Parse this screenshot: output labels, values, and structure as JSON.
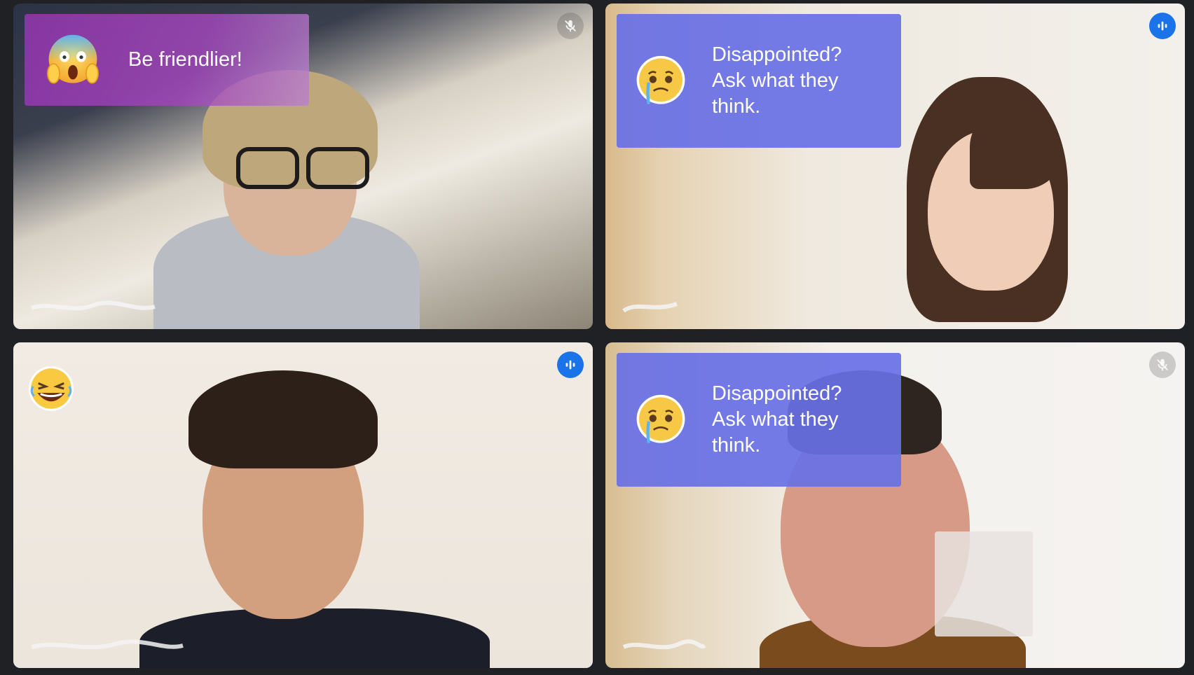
{
  "participants": [
    {
      "prompt": {
        "text": "Be friendlier!",
        "emoji": "face-screaming-in-fear-emoji"
      },
      "mic": {
        "state": "muted",
        "icon": "mic-off-icon"
      }
    },
    {
      "prompt": {
        "text": "Disappointed?\nAsk what they\nthink.",
        "emoji": "crying-face-emoji"
      },
      "mic": {
        "state": "speaking",
        "icon": "audio-level-icon"
      }
    },
    {
      "reaction": {
        "emoji": "laughing-face-emoji"
      },
      "mic": {
        "state": "speaking",
        "icon": "audio-level-icon"
      },
      "active": true
    },
    {
      "prompt": {
        "text": "Disappointed?\nAsk what they\nthink.",
        "emoji": "crying-face-emoji"
      },
      "mic": {
        "state": "muted",
        "icon": "mic-off-icon"
      }
    }
  ],
  "colors": {
    "active_outline": "#5b8def",
    "speaking_blue": "#1a73e8",
    "prompt_purple": "#8e36aa",
    "prompt_blue": "#6870e6",
    "background": "#1f2124"
  }
}
